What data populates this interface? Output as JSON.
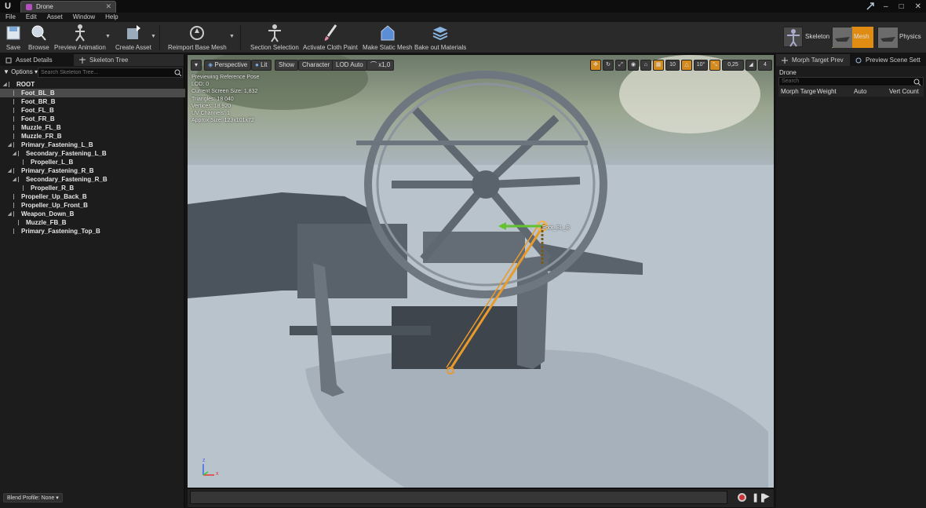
{
  "window": {
    "tab_title": "Drone",
    "controls": [
      "–",
      "□",
      "✕"
    ]
  },
  "menu": [
    "File",
    "Edit",
    "Asset",
    "Window",
    "Help"
  ],
  "toolbar": {
    "save": "Save",
    "browse": "Browse",
    "preview_animation": "Preview Animation",
    "create_asset": "Create Asset",
    "reimport_base_mesh": "Reimport Base Mesh",
    "section_selection": "Section Selection",
    "activate_cloth_paint": "Activate Cloth Paint",
    "make_static_mesh": "Make Static Mesh",
    "bake_out_materials": "Bake out Materials",
    "modes": {
      "skeleton": "Skeleton",
      "mesh": "Mesh",
      "physics": "Physics"
    }
  },
  "left_panel": {
    "tabs": [
      "Asset Details",
      "Skeleton Tree"
    ],
    "options_label": "Options",
    "search_placeholder": "Search Skeleton Tree...",
    "tree": [
      {
        "label": "ROOT",
        "depth": 0,
        "expander": true
      },
      {
        "label": "Foot_BL_B",
        "depth": 1,
        "selected": true
      },
      {
        "label": "Foot_BR_B",
        "depth": 1
      },
      {
        "label": "Foot_FL_B",
        "depth": 1
      },
      {
        "label": "Foot_FR_B",
        "depth": 1
      },
      {
        "label": "Muzzle_FL_B",
        "depth": 1
      },
      {
        "label": "Muzzle_FR_B",
        "depth": 1
      },
      {
        "label": "Primary_Fastening_L_B",
        "depth": 1,
        "expander": true
      },
      {
        "label": "Secondary_Fastening_L_B",
        "depth": 2,
        "expander": true
      },
      {
        "label": "Propeller_L_B",
        "depth": 3
      },
      {
        "label": "Primary_Fastening_R_B",
        "depth": 1,
        "expander": true
      },
      {
        "label": "Secondary_Fastening_R_B",
        "depth": 2,
        "expander": true
      },
      {
        "label": "Propeller_R_B",
        "depth": 3
      },
      {
        "label": "Propeller_Up_Back_B",
        "depth": 1
      },
      {
        "label": "Propeller_Up_Front_B",
        "depth": 1
      },
      {
        "label": "Weapon_Down_B",
        "depth": 1,
        "expander": true
      },
      {
        "label": "Muzzle_FB_B",
        "depth": 2
      },
      {
        "label": "Primary_Fastening_Top_B",
        "depth": 1
      }
    ],
    "blend_profile": "Blend Profile: None"
  },
  "viewport": {
    "perspective": "Perspective",
    "lit": "Lit",
    "show": "Show",
    "character": "Character",
    "lod": "LOD Auto",
    "speed": "x1,0",
    "grid_snap": "10",
    "rot_snap": "10°",
    "scale_snap": "0,25",
    "cam_speed": "4",
    "info": [
      "Previewing Reference Pose",
      "LOD: 0",
      "Current Screen Size: 1,832",
      "Triangles: 18 040",
      "Vertices: 18 920",
      "UV Channels: 1",
      "Approx Size: 123x101x72"
    ],
    "selected_bone_label": "Foot_BL_B",
    "axis_z": "z",
    "axis_x": "x",
    "colors": {
      "ground": "#b8c3cc",
      "drone": "#5e6670",
      "bone": "#e89a2a"
    }
  },
  "right_panel": {
    "tabs": [
      "Morph Target Prev",
      "Preview Scene Sett"
    ],
    "mesh_name": "Drone",
    "search_placeholder": "Search",
    "columns": [
      "Morph Targe",
      "Weight",
      "Auto",
      "Vert Count"
    ]
  }
}
